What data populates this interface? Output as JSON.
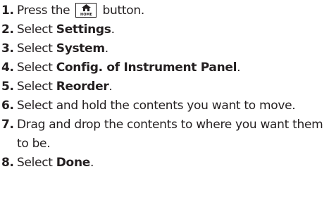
{
  "steps": [
    {
      "number": "1.",
      "before": "Press the ",
      "after": " button.",
      "icon": "home-button-icon",
      "icon_label": "HOME"
    },
    {
      "number": "2.",
      "before": "Select ",
      "bold": "Settings",
      "after": "."
    },
    {
      "number": "3.",
      "before": "Select ",
      "bold": "System",
      "after": "."
    },
    {
      "number": "4.",
      "before": "Select ",
      "bold": "Config. of Instrument Panel",
      "after": "."
    },
    {
      "number": "5.",
      "before": "Select ",
      "bold": "Reorder",
      "after": "."
    },
    {
      "number": "6.",
      "text": "Select and hold the contents you want to move."
    },
    {
      "number": "7.",
      "text": "Drag and drop the contents to where you want them to be."
    },
    {
      "number": "8.",
      "before": "Select ",
      "bold": "Done",
      "after": "."
    }
  ]
}
